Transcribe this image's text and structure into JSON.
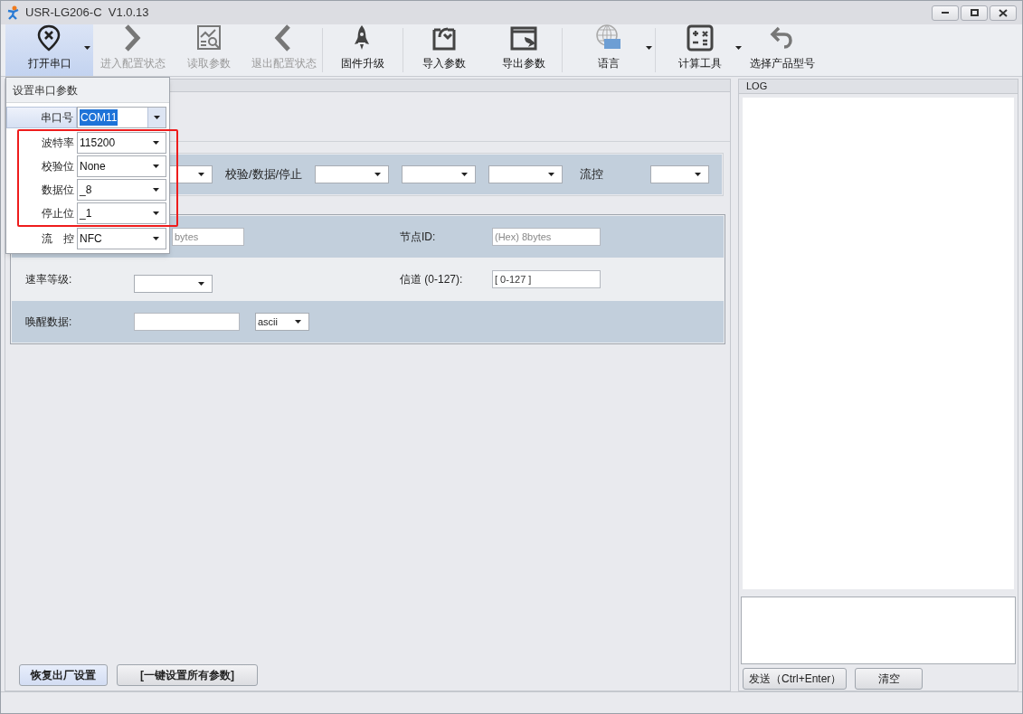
{
  "window": {
    "title": "USR-LG206-C  V1.0.13"
  },
  "toolbar": [
    {
      "kind": "open-port",
      "label": "打开串口",
      "enabled": true,
      "selected": true,
      "dropdown": true
    },
    {
      "kind": "enter",
      "label": "进入配置状态",
      "enabled": false,
      "selected": false,
      "dropdown": false
    },
    {
      "kind": "read",
      "label": "读取参数",
      "enabled": false,
      "selected": false,
      "dropdown": false
    },
    {
      "kind": "exit",
      "label": "退出配置状态",
      "enabled": false,
      "selected": false,
      "dropdown": false
    },
    {
      "kind": "firmware",
      "label": "固件升级",
      "enabled": true,
      "selected": false,
      "dropdown": false
    },
    {
      "kind": "import",
      "label": "导入参数",
      "enabled": true,
      "selected": false,
      "dropdown": false
    },
    {
      "kind": "export",
      "label": "导出参数",
      "enabled": true,
      "selected": false,
      "dropdown": false
    },
    {
      "kind": "language",
      "label": "语言",
      "enabled": true,
      "selected": false,
      "dropdown": true
    },
    {
      "kind": "calculator",
      "label": "计算工具",
      "enabled": true,
      "selected": false,
      "dropdown": true
    },
    {
      "kind": "select-model",
      "label": "选择产品型号",
      "enabled": true,
      "selected": false,
      "dropdown": false
    }
  ],
  "serial_popup": {
    "title": "设置串口参数",
    "rows": [
      {
        "label": "串口号",
        "value": "COM11",
        "selected": true,
        "marked": false
      },
      {
        "label": "波特率",
        "value": "115200",
        "selected": false,
        "marked": true
      },
      {
        "label": "校验位",
        "value": "None",
        "selected": false,
        "marked": true
      },
      {
        "label": "数据位",
        "value": "_8",
        "selected": false,
        "marked": true
      },
      {
        "label": "停止位",
        "value": "_1",
        "selected": false,
        "marked": true
      },
      {
        "label": "流　控",
        "value": "NFC",
        "selected": false,
        "marked": false
      }
    ]
  },
  "config_bar": [
    {
      "kind": "combo"
    },
    {
      "kind": "label",
      "text": "校验/数据/停止"
    },
    {
      "kind": "combo"
    },
    {
      "kind": "combo"
    },
    {
      "kind": "combo"
    },
    {
      "kind": "label",
      "text": "流控"
    },
    {
      "kind": "combo"
    }
  ],
  "node_rows": [
    {
      "shaded": true,
      "left": {
        "control": {
          "kind": "field",
          "placeholder": "bytes"
        }
      },
      "right": {
        "label": "节点ID:",
        "control": {
          "kind": "field",
          "placeholder": "(Hex) 8bytes"
        }
      }
    },
    {
      "shaded": false,
      "left": {
        "label": "速率等级:",
        "control": {
          "kind": "combo"
        }
      },
      "right": {
        "label": "信道 (0-127):",
        "control": {
          "kind": "field",
          "value": "[ 0-127 ]"
        }
      }
    },
    {
      "shaded": true,
      "left": {
        "label": "唤醒数据:",
        "control": {
          "kind": "field-combo",
          "combo_value": "ascii"
        }
      }
    }
  ],
  "buttons": [
    {
      "label": "恢复出厂设置",
      "selected": true
    },
    {
      "label": "[一键设置所有参数]",
      "selected": false
    }
  ],
  "log": {
    "title": "LOG",
    "buttons": [
      "发送（Ctrl+Enter）",
      "清空"
    ]
  }
}
